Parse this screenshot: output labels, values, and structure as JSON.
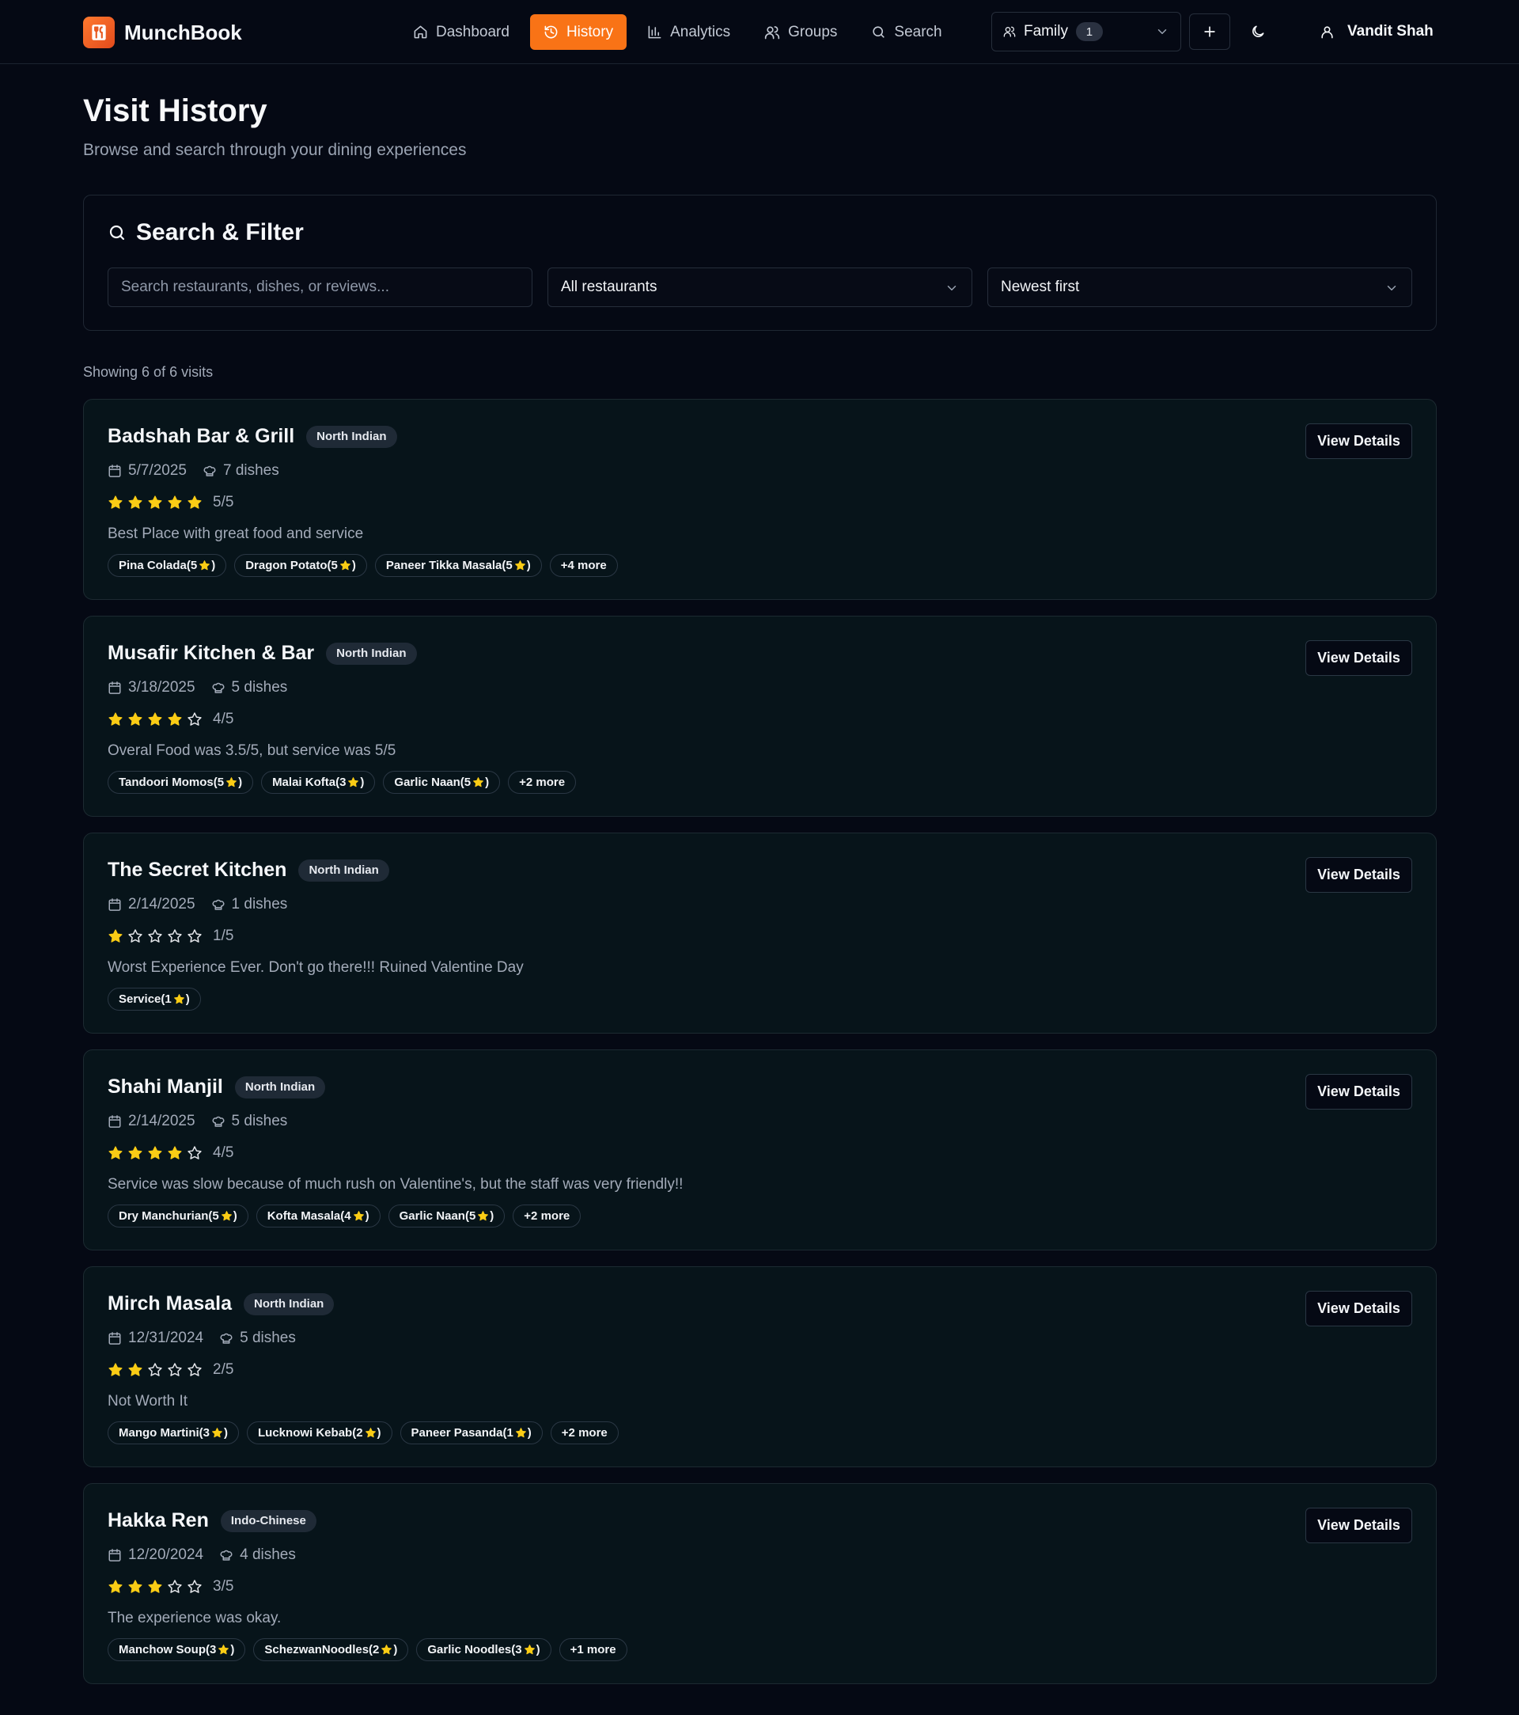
{
  "app": {
    "name": "MunchBook",
    "accent": "#f97316",
    "logo_icon": "restaurant-menu-icon"
  },
  "nav": [
    {
      "label": "Dashboard",
      "icon": "home-icon",
      "active": false
    },
    {
      "label": "History",
      "icon": "history-icon",
      "active": true
    },
    {
      "label": "Analytics",
      "icon": "bar-chart-icon",
      "active": false
    },
    {
      "label": "Groups",
      "icon": "users-icon",
      "active": false
    },
    {
      "label": "Search",
      "icon": "search-icon",
      "active": false
    }
  ],
  "group_selector": {
    "label": "Family",
    "count": "1"
  },
  "user": {
    "name": "Vandit Shah"
  },
  "page": {
    "title": "Visit History",
    "subtitle": "Browse and search through your dining experiences"
  },
  "filters": {
    "title": "Search & Filter",
    "search_placeholder": "Search restaurants, dishes, or reviews...",
    "restaurant_filter": "All restaurants",
    "sort": "Newest first"
  },
  "results_summary": "Showing 6 of 6 visits",
  "colors": {
    "star": "#facc15",
    "star_empty": "#e5e7eb"
  },
  "visits": [
    {
      "name": "Badshah Bar & Grill",
      "cuisine": "North Indian",
      "date": "5/7/2025",
      "dishes_count": "7 dishes",
      "rating": 5,
      "rating_text": "5/5",
      "review": "Best Place with great food and service",
      "dishes": [
        {
          "name": "Pina Colada",
          "rating": "5"
        },
        {
          "name": "Dragon Potato",
          "rating": "5"
        },
        {
          "name": "Paneer Tikka Masala",
          "rating": "5"
        }
      ],
      "more": "+4 more",
      "action": "View Details"
    },
    {
      "name": "Musafir Kitchen & Bar",
      "cuisine": "North Indian",
      "date": "3/18/2025",
      "dishes_count": "5 dishes",
      "rating": 4,
      "rating_text": "4/5",
      "review": "Overal Food was 3.5/5, but service was 5/5",
      "dishes": [
        {
          "name": "Tandoori Momos",
          "rating": "5"
        },
        {
          "name": "Malai Kofta",
          "rating": "3"
        },
        {
          "name": "Garlic Naan",
          "rating": "5"
        }
      ],
      "more": "+2 more",
      "action": "View Details"
    },
    {
      "name": "The Secret Kitchen",
      "cuisine": "North Indian",
      "date": "2/14/2025",
      "dishes_count": "1 dishes",
      "rating": 1,
      "rating_text": "1/5",
      "review": "Worst Experience Ever. Don't go there!!! Ruined Valentine Day",
      "dishes": [
        {
          "name": "Service",
          "rating": "1"
        }
      ],
      "more": "",
      "action": "View Details"
    },
    {
      "name": "Shahi Manjil",
      "cuisine": "North Indian",
      "date": "2/14/2025",
      "dishes_count": "5 dishes",
      "rating": 4,
      "rating_text": "4/5",
      "review": "Service was slow because of much rush on Valentine's, but the staff was very friendly!!",
      "dishes": [
        {
          "name": "Dry Manchurian",
          "rating": "5"
        },
        {
          "name": "Kofta Masala",
          "rating": "4"
        },
        {
          "name": "Garlic Naan",
          "rating": "5"
        }
      ],
      "more": "+2 more",
      "action": "View Details"
    },
    {
      "name": "Mirch Masala",
      "cuisine": "North Indian",
      "date": "12/31/2024",
      "dishes_count": "5 dishes",
      "rating": 2,
      "rating_text": "2/5",
      "review": "Not Worth It",
      "dishes": [
        {
          "name": "Mango Martini",
          "rating": "3"
        },
        {
          "name": "Lucknowi Kebab",
          "rating": "2"
        },
        {
          "name": "Paneer Pasanda",
          "rating": "1"
        }
      ],
      "more": "+2 more",
      "action": "View Details"
    },
    {
      "name": "Hakka Ren",
      "cuisine": "Indo-Chinese",
      "date": "12/20/2024",
      "dishes_count": "4 dishes",
      "rating": 3,
      "rating_text": "3/5",
      "review": "The experience was okay.",
      "dishes": [
        {
          "name": "Manchow Soup",
          "rating": "3"
        },
        {
          "name": "SchezwanNoodles",
          "rating": "2"
        },
        {
          "name": "Garlic Noodles",
          "rating": "3"
        }
      ],
      "more": "+1 more",
      "action": "View Details"
    }
  ]
}
